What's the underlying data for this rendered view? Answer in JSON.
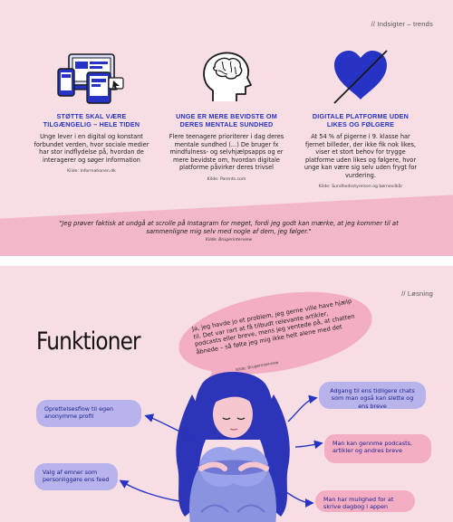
{
  "colors": {
    "background": "#f7dde4",
    "accent_blue": "#2633c4",
    "band_pink": "#f2b8c9",
    "bubble_pink": "#f3aec3",
    "pill_purple": "#b8b3ea"
  },
  "slide1": {
    "tag": "// Indsigter – trends",
    "columns": [
      {
        "icon": "devices-icon",
        "heading": "STØTTE SKAL VÆRE TILGÆNGELIG – HELE TIDEN",
        "body": "Unge lever i en digital og konstant forbundet verden, hvor sociale medier har stor indflydelse på, hvordan de interagerer og søger information",
        "source": "Kilde: Informationen.dk"
      },
      {
        "icon": "head-brain-icon",
        "heading": "UNGE ER MERE BEVIDSTE OM DERES MENTALE SUNDHED",
        "body": "Flere teenagere prioriterer i dag deres mentale sundhed (...) De bruger fx mindfulness- og selvhjælpsapps og er mere bevidste om, hvordan digitale platforme påvirker deres trivsel",
        "source": "Kilde: Parents.com"
      },
      {
        "icon": "crossed-heart-icon",
        "heading": "DIGITALE PLATFORME UDEN LIKES OG FØLGERE",
        "body": "At 54 % af pigerne i 9. klasse har fjernet billeder, der ikke fik nok likes, viser et stort behov for trygge platforme uden likes og følgere, hvor unge kan være sig selv uden frygt for vurdering.",
        "source": "Kilde: Sundhedsstyrelsen og børnevilkår"
      }
    ],
    "quote": "\"Jeg prøver faktisk at undgå at scrolle på Instagram for meget, fordi jeg godt kan mærke, at jeg kommer til at sammenligne mig selv med nogle af dem, jeg følger.\"",
    "quote_source": "Kilde: Brugerinterview"
  },
  "slide2": {
    "tag": "// Løsning",
    "title": "Funktioner",
    "bubble_quote": "Ja, jeg havde jo et problem, jeg gerne ville have hjælp til. Det var rart at få tilbudt relevante artikler, podcasts eller breve, mens jeg ventede på, at chatten åbnede – så følte jeg mig ikke helt alene med det",
    "bubble_source": "Kilde: Brugerinterview",
    "features": {
      "left_top": "Oprettelsesflow til egen anonymme profil",
      "left_bottom": "Valg af emner som personliggøre ens feed",
      "right_top": "Adgang til ens tidligere chats som man også kan slette og ens breve",
      "right_middle": "Man kan gennme podcasts, artikler og andres breve",
      "right_bottom": "Man har mulighed for at skrive dagbog i appen"
    },
    "illustration": "girl-hugging-knees-illustration"
  }
}
